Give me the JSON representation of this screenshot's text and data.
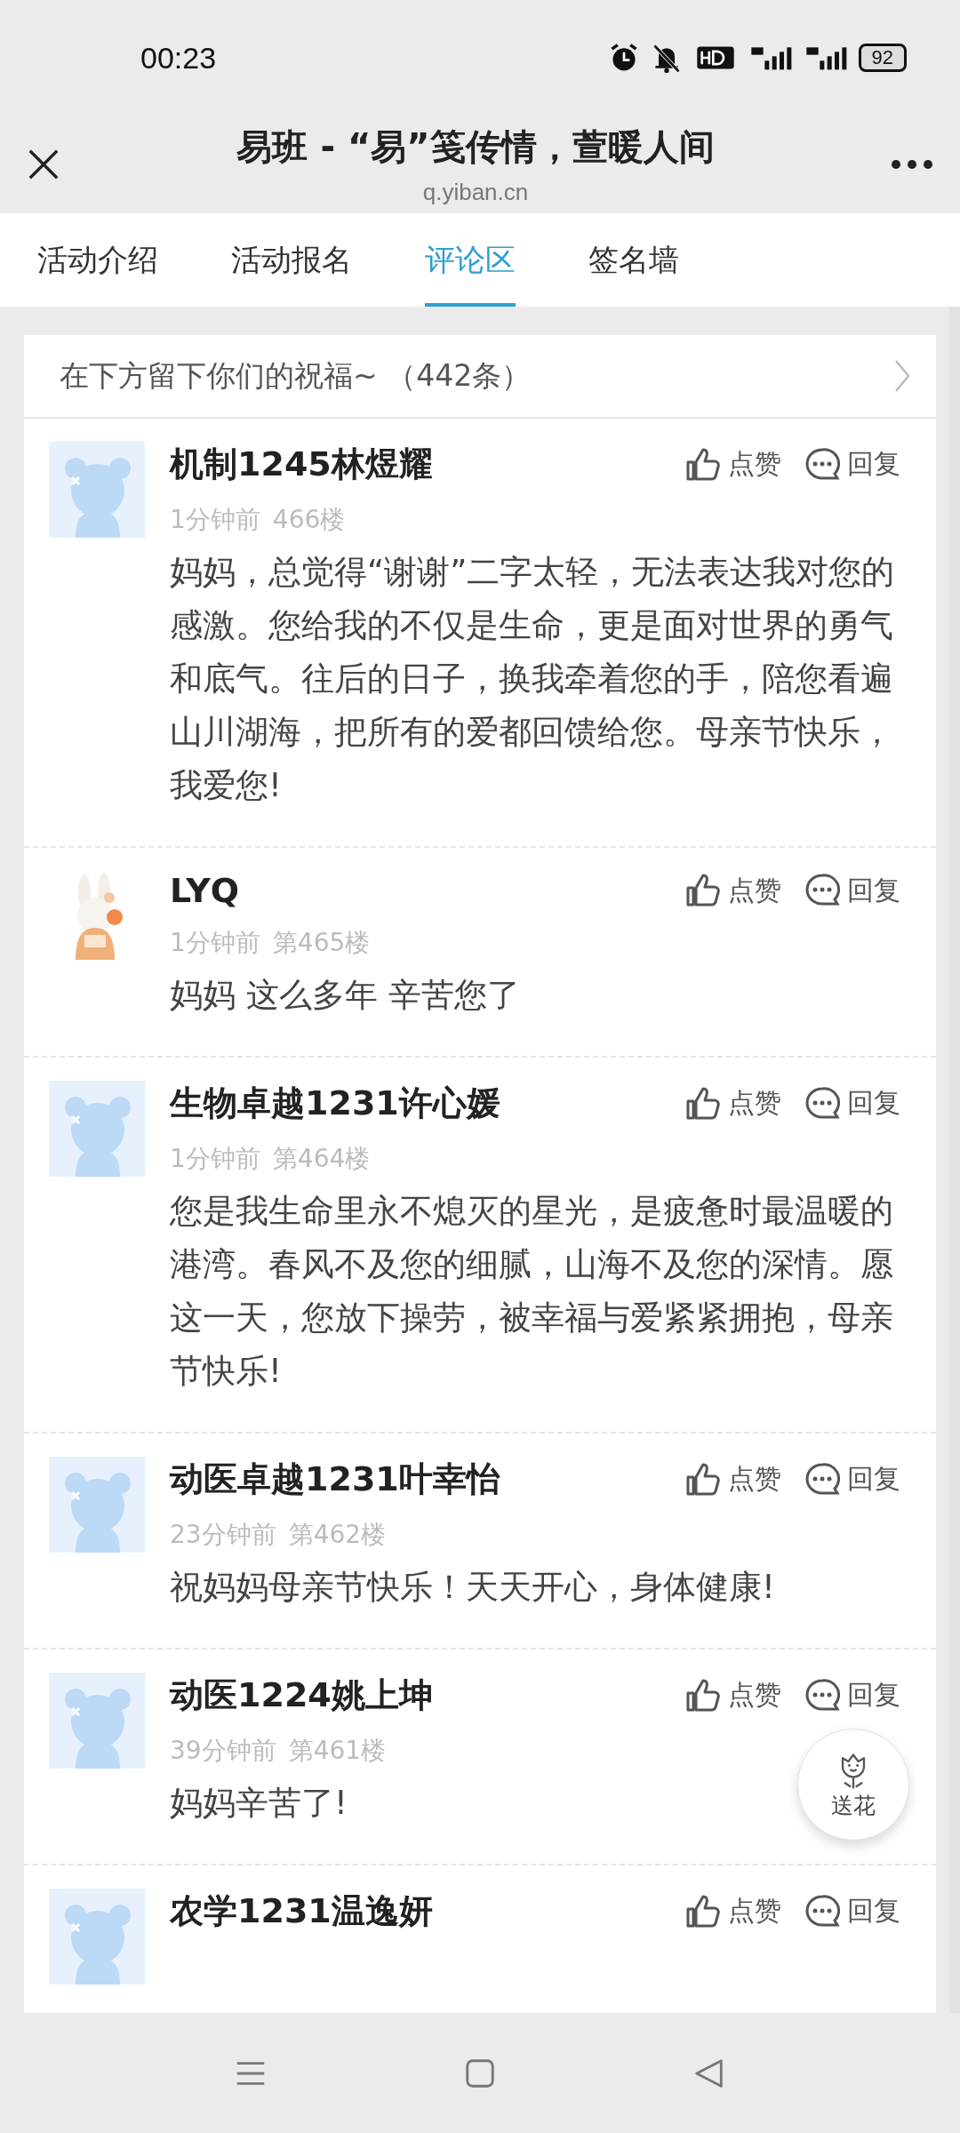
{
  "status_bar": {
    "time": "00:23",
    "battery": "92"
  },
  "header": {
    "title": "易班 - “易”笺传情，萱暖人间",
    "url": "q.yiban.cn"
  },
  "tabs": [
    {
      "label": "活动介绍",
      "selected": false
    },
    {
      "label": "活动报名",
      "selected": false
    },
    {
      "label": "评论区",
      "selected": true
    },
    {
      "label": "签名墙",
      "selected": false
    }
  ],
  "comments_header": {
    "text": "在下方留下你们的祝福~ （442条）"
  },
  "comments": [
    {
      "avatar": {
        "kind": "default"
      },
      "name": "机制1245林煜耀",
      "time": "1分钟前",
      "floor": "466楼",
      "like": "点赞",
      "reply": "回复",
      "text": "妈妈，总觉得“谢谢”二字太轻，无法表达我对您的感激。您给我的不仅是生命，更是面对世界的勇气和底气。往后的日子，换我牵着您的手，陪您看遍山川湖海，把所有的爱都回馈给您。母亲节快乐，我爱您!"
    },
    {
      "name": "LYQ",
      "time": "1分钟前",
      "floor": "第465楼",
      "like": "点赞",
      "reply": "回复",
      "text": "妈妈 这么多年 辛苦您了"
    },
    {
      "avatar": {
        "kind": "default"
      },
      "name": "生物卓越1231许心媛",
      "time": "1分钟前",
      "floor": "第464楼",
      "like": "点赞",
      "reply": "回复",
      "text": "您是我生命里永不熄灭的星光，是疲惫时最温暖的港湾。春风不及您的细腻，山海不及您的深情。愿这一天，您放下操劳，被幸福与爱紧紧拥抱，母亲节快乐!"
    },
    {
      "avatar": {
        "kind": "default"
      },
      "name": "动医卓越1231叶幸怡",
      "time": "23分钟前",
      "floor": "第462楼",
      "like": "点赞",
      "reply": "回复",
      "text": "祝妈妈母亲节快乐！天天开心，身体健康!"
    },
    {
      "avatar": {
        "kind": "default"
      },
      "name": "动医1224姚上坤",
      "time": "39分钟前",
      "floor": "第461楼",
      "like": "点赞",
      "reply": "回复",
      "text": "妈妈辛苦了!"
    },
    {
      "avatar": {
        "kind": "default"
      },
      "name": "农学1231温逸妍",
      "like": "点赞",
      "reply": "回复"
    }
  ],
  "float_button": {
    "label": "送花"
  }
}
